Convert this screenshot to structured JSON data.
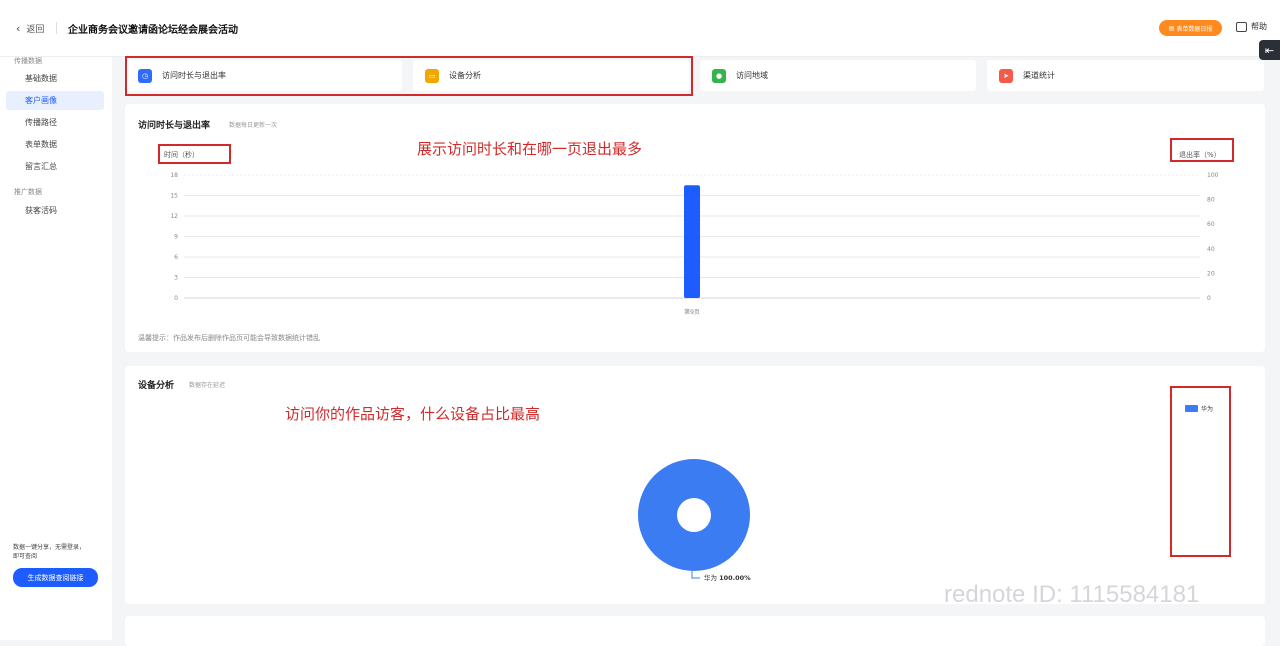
{
  "header": {
    "back_label": "返回",
    "title": "企业商务会议邀请函论坛经会展会活动",
    "report_button": "表单数据日报",
    "help_label": "帮助",
    "collapse_icon": "collapse-left-icon"
  },
  "sidebar": {
    "group1": "传播数据",
    "items1": [
      "基础数据",
      "客户画像",
      "传播路径",
      "表单数据",
      "留言汇总"
    ],
    "group2": "推广数据",
    "items2": [
      "获客活码"
    ],
    "note_line1": "数据一键分享，无需登录，",
    "note_line2": "即可查阅",
    "cta": "生成数据查阅链接"
  },
  "tabs": [
    {
      "label": "访问时长与退出率",
      "icon": "clock-icon",
      "color": "#2f6bff"
    },
    {
      "label": "设备分析",
      "icon": "device-icon",
      "color": "#f0a800"
    },
    {
      "label": "访问地域",
      "icon": "location-icon",
      "color": "#36b34a"
    },
    {
      "label": "渠道统计",
      "icon": "send-icon",
      "color": "#f25a4a"
    }
  ],
  "section1": {
    "title": "访问时长与退出率",
    "subtitle": "数据每日更新一次",
    "annotation": "展示访问时长和在哪一页退出最多",
    "tip": "温馨提示：作品发布后删除作品页可能会导致数据统计错乱"
  },
  "section2": {
    "title": "设备分析",
    "subtitle": "数据存在延迟",
    "annotation": "访问你的作品访客，什么设备占比最高"
  },
  "chart_data": [
    {
      "type": "bar",
      "categories": [
        "第9页"
      ],
      "series": [
        {
          "values": [
            16.5
          ]
        }
      ],
      "ylabel": "时间（秒）",
      "y2label": "退出率（%）",
      "ylim": [
        0,
        18
      ],
      "yticks": [
        "0",
        "3",
        "6",
        "9",
        "12",
        "15",
        "18"
      ],
      "y2lim": [
        0,
        100
      ],
      "y2ticks": [
        "0",
        "20",
        "40",
        "60",
        "80",
        "100"
      ],
      "grid": true,
      "color": "#1d5cff"
    },
    {
      "type": "pie",
      "labels": [
        "华为"
      ],
      "values": [
        100.0
      ],
      "data_labels": [
        "100.00%"
      ],
      "legend": [
        "华为"
      ],
      "legend_position": "top-right",
      "color": "#3b7cf2"
    }
  ],
  "watermark": "rednote ID: 1115584181"
}
